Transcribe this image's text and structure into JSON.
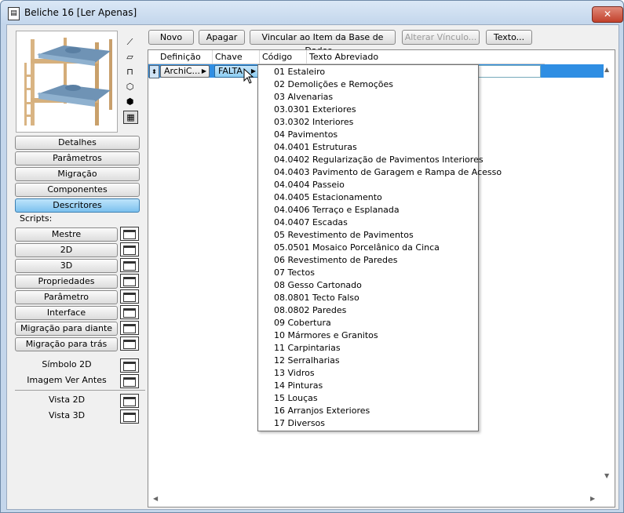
{
  "window": {
    "title": "Beliche 16 [Ler Apenas]",
    "close_label": "✕"
  },
  "left": {
    "tabs": [
      "Detalhes",
      "Parâmetros",
      "Migração",
      "Componentes",
      "Descritores"
    ],
    "scripts_label": "Scripts:",
    "scripts": [
      "Mestre",
      "2D",
      "3D",
      "Propriedades",
      "Parâmetro",
      "Interface",
      "Migração para diante",
      "Migração para trás"
    ],
    "symbol_label": "Símbolo 2D",
    "image_label": "Imagem Ver Antes",
    "view2d_label": "Vista 2D",
    "view3d_label": "Vista 3D"
  },
  "toolbar": {
    "new_label": "Novo",
    "delete_label": "Apagar",
    "link_label": "Vincular ao Item da Base de Dados...",
    "alter_label": "Alterar Vínculo...",
    "text_label": "Texto..."
  },
  "table": {
    "headers": [
      "Definição",
      "Chave",
      "Código",
      "Texto Abreviado"
    ],
    "row": {
      "definition": "ArchiC...",
      "key": "FALTA"
    }
  },
  "dropdown": {
    "items": [
      "01 Estaleiro",
      "02 Demolições e Remoções",
      "03 Alvenarias",
      "03.0301 Exteriores",
      "03.0302 Interiores",
      "04 Pavimentos",
      "04.0401 Estruturas",
      "04.0402 Regularização de Pavimentos Interiores",
      "04.0403 Pavimento de Garagem e Rampa de Acesso",
      "04.0404 Passeio",
      "04.0405 Estacionamento",
      "04.0406 Terraço e Esplanada",
      "04.0407 Escadas",
      "05 Revestimento de Pavimentos",
      "05.0501 Mosaico Porcelânico da Cinca",
      "06 Revestimento de Paredes",
      "07 Tectos",
      "08 Gesso Cartonado",
      "08.0801 Tecto Falso",
      "08.0802 Paredes",
      "09 Cobertura",
      "10 Mármores e Granitos",
      "11 Carpintarias",
      "12 Serralharias",
      "13 Vidros",
      "14 Pinturas",
      "15 Louças",
      "16 Arranjos Exteriores",
      "17 Diversos"
    ]
  }
}
